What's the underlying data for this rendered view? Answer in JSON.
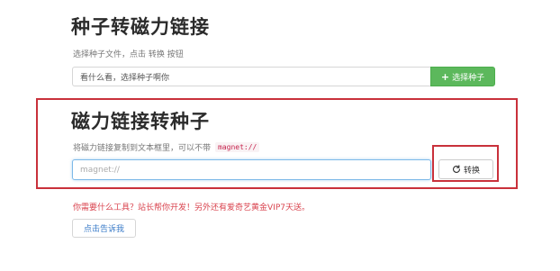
{
  "torrent_to_magnet": {
    "title": "种子转磁力链接",
    "description": "选择种子文件，点击 转换 按钮",
    "input_value": "看什么看，选择种子啊你",
    "select_button_label": "选择种子"
  },
  "magnet_to_torrent": {
    "title": "磁力链接转种子",
    "description": "将磁力链接复制到文本框里，可以不带",
    "code_hint": "magnet://",
    "input_placeholder": "magnet://",
    "convert_button_label": "转换"
  },
  "footer": {
    "notice": "你需要什么工具？站长帮你开发！另外还有爱奇艺黄金VIP7天送。",
    "tell_button_label": "点击告诉我"
  },
  "colors": {
    "accent_green": "#5cb85c",
    "highlight_red": "#c9313b",
    "notice_red": "#d9434e",
    "link_blue": "#3a7bc8"
  },
  "icons": {
    "select_button": "plus-icon",
    "convert_button": "refresh-icon"
  }
}
